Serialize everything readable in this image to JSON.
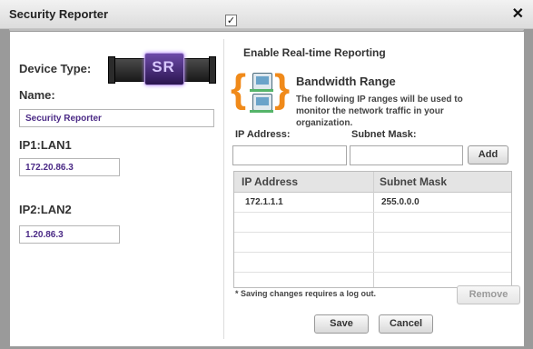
{
  "window": {
    "title": "Security Reporter",
    "close_glyph": "✕"
  },
  "left": {
    "device_type_label": "Device Type:",
    "device_badge": "SR",
    "name_label": "Name:",
    "name_value": "Security Reporter",
    "ip1_label": "IP1:LAN1",
    "ip1_value": "172.20.86.3",
    "ip2_label": "IP2:LAN2",
    "ip2_value": "1.20.86.3"
  },
  "right": {
    "enable_label": "Enable Real-time Reporting",
    "enable_checked": true,
    "check_glyph": "✓",
    "bandwidth_title": "Bandwidth Range",
    "bandwidth_desc": "The following IP ranges will be used to monitor the network traffic in your organization.",
    "ip_address_label": "IP Address:",
    "subnet_mask_label": "Subnet Mask:",
    "add_label": "Add",
    "table": {
      "headers": [
        "IP Address",
        "Subnet Mask"
      ],
      "rows": [
        [
          "172.1.1.1",
          "255.0.0.0"
        ],
        [
          "",
          ""
        ],
        [
          "",
          ""
        ],
        [
          "",
          ""
        ]
      ]
    },
    "note": "* Saving changes requires a log out.",
    "remove_label": "Remove",
    "save_label": "Save",
    "cancel_label": "Cancel"
  },
  "colors": {
    "accent_bracket": "#f08a1a",
    "value_text": "#4b2a86"
  },
  "icons": [
    "close-icon",
    "device-icon",
    "network-computers-icon",
    "checkbox-checked-icon"
  ]
}
